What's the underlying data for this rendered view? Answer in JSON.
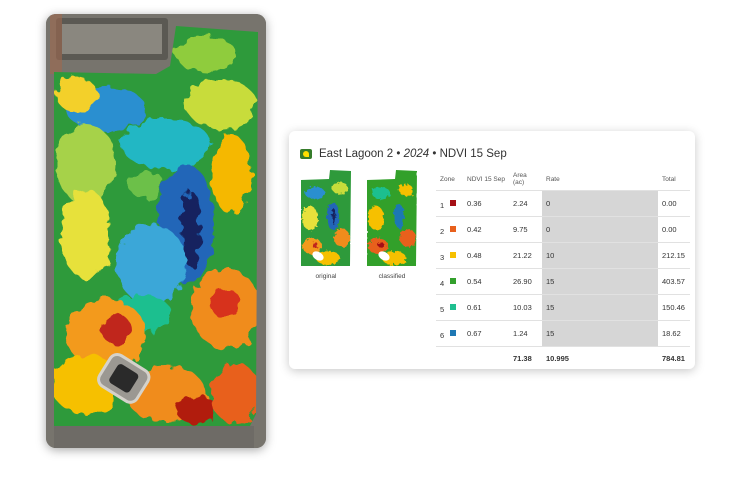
{
  "card": {
    "title_field": "East Lagoon 2",
    "title_sep": " • ",
    "title_year": "2024",
    "title_layer": "NDVI 15 Sep"
  },
  "thumbnails": {
    "original_label": "original",
    "classified_label": "classified"
  },
  "table": {
    "headers": [
      "Zone",
      "NDVI 15 Sep",
      "Area (ac)",
      "Rate",
      "Total"
    ],
    "rows": [
      {
        "zone": "1",
        "color": "#a50f15",
        "ndvi": "0.36",
        "area": "2.24",
        "rate": "0",
        "total": "0.00"
      },
      {
        "zone": "2",
        "color": "#e8601c",
        "ndvi": "0.42",
        "area": "9.75",
        "rate": "0",
        "total": "0.00"
      },
      {
        "zone": "3",
        "color": "#f6c000",
        "ndvi": "0.48",
        "area": "21.22",
        "rate": "10",
        "total": "212.15"
      },
      {
        "zone": "4",
        "color": "#33a02c",
        "ndvi": "0.54",
        "area": "26.90",
        "rate": "15",
        "total": "403.57"
      },
      {
        "zone": "5",
        "color": "#1fbf8f",
        "ndvi": "0.61",
        "area": "10.03",
        "rate": "15",
        "total": "150.46"
      },
      {
        "zone": "6",
        "color": "#1f78b4",
        "ndvi": "0.67",
        "area": "1.24",
        "rate": "15",
        "total": "18.62"
      }
    ],
    "totals": {
      "area": "71.38",
      "rate": "10.995",
      "total": "784.81"
    }
  },
  "colors": {
    "brand_green": "#367c2b",
    "brand_yellow": "#ffde00",
    "rate_column_bg": "#d6d6d6"
  }
}
